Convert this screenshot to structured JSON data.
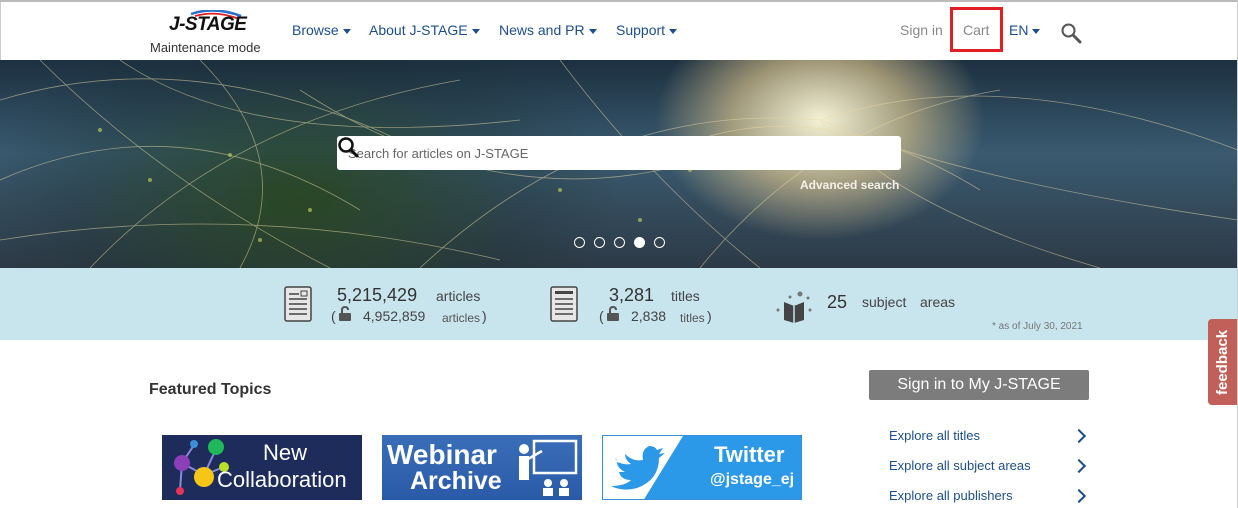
{
  "header": {
    "logo_text": "J-STAGE",
    "maintenance": "Maintenance mode",
    "nav": [
      {
        "label": "Browse"
      },
      {
        "label": "About J-STAGE"
      },
      {
        "label": "News and PR"
      },
      {
        "label": "Support"
      }
    ],
    "sign_in": "Sign in",
    "cart": "Cart",
    "language": "EN"
  },
  "hero": {
    "search_placeholder": "Search for articles on J-STAGE",
    "advanced_search": "Advanced search",
    "carousel_dots": 5,
    "carousel_active": 4
  },
  "stats": {
    "articles_count": "5,215,429",
    "articles_label": "articles",
    "open_articles_count": "4,952,859",
    "open_articles_label": "articles",
    "titles_count": "3,281",
    "titles_label": "titles",
    "open_titles_count": "2,838",
    "open_titles_label": "titles",
    "subjects_count": "25",
    "subjects_label1": "subject",
    "subjects_label2": "areas",
    "as_of": "* as of July 30, 2021"
  },
  "featured": {
    "heading": "Featured Topics",
    "banners": [
      {
        "line1": "New",
        "line2": "Collaboration"
      },
      {
        "line1": "Webinar",
        "line2": "Archive"
      },
      {
        "line1": "Twitter",
        "line2": "@jstage_ej"
      }
    ]
  },
  "sidebar": {
    "sign_in_button": "Sign in to My J-STAGE",
    "links": [
      {
        "label": "Explore all titles"
      },
      {
        "label": "Explore all subject areas"
      },
      {
        "label": "Explore all publishers"
      }
    ]
  },
  "feedback": "feedback",
  "colors": {
    "nav_blue": "#1d4e89",
    "cart_highlight": "#e31e24",
    "stats_bg": "#c8e4ed",
    "feedback_bg": "#c06058"
  }
}
